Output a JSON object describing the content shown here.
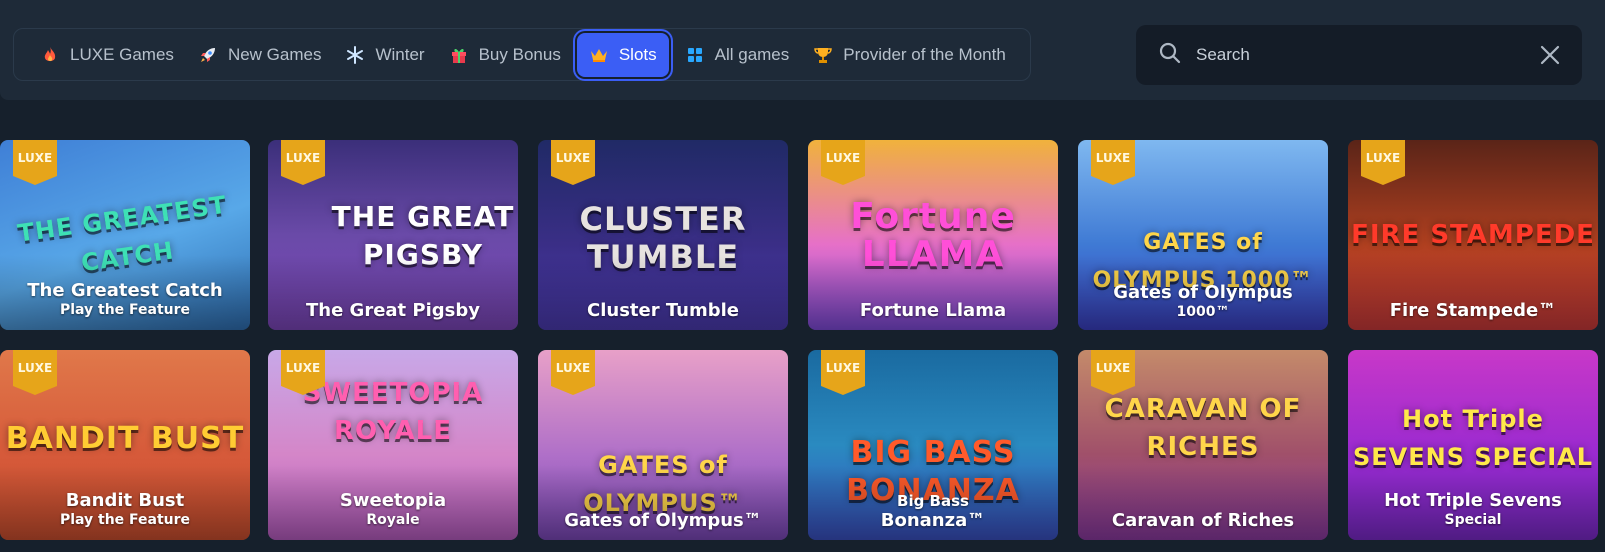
{
  "categories": [
    {
      "label": "LUXE Games",
      "icon": "flame-icon",
      "active": false
    },
    {
      "label": "New Games",
      "icon": "rocket-icon",
      "active": false
    },
    {
      "label": "Winter",
      "icon": "snowflake-icon",
      "active": false
    },
    {
      "label": "Buy Bonus",
      "icon": "gift-icon",
      "active": false
    },
    {
      "label": "Slots",
      "icon": "crown-icon",
      "active": true
    },
    {
      "label": "All games",
      "icon": "grid-icon",
      "active": false
    },
    {
      "label": "Provider of the Month",
      "icon": "trophy-icon",
      "active": false
    }
  ],
  "search": {
    "placeholder": "Search"
  },
  "badge_label": "LUXE",
  "games": [
    {
      "title": "The Greatest Catch",
      "subtitle": "Play the Feature",
      "logo": "THE GREATEST CATCH",
      "luxe": true
    },
    {
      "title": "The Great Pigsby",
      "subtitle": "",
      "logo": "THE GREAT PIGSBY",
      "luxe": true
    },
    {
      "title": "Cluster Tumble",
      "subtitle": "",
      "logo": "CLUSTER TUMBLE",
      "luxe": true
    },
    {
      "title": "Fortune Llama",
      "subtitle": "",
      "logo": "Fortune LLAMA",
      "luxe": true
    },
    {
      "title": "Gates of Olympus",
      "subtitle": "1000™",
      "logo": "GATES of OLYMPUS 1000™",
      "luxe": true
    },
    {
      "title": "Fire Stampede™",
      "subtitle": "",
      "logo": "FIRE STAMPEDE",
      "luxe": true
    },
    {
      "title": "Bandit Bust",
      "subtitle": "Play the Feature",
      "logo": "BANDIT BUST",
      "luxe": true
    },
    {
      "title": "Sweetopia",
      "subtitle": "Royale",
      "logo": "SWEETOPIA ROYALE",
      "luxe": true
    },
    {
      "title": "Gates of Olympus™",
      "subtitle": "",
      "logo": "GATES of OLYMPUS™",
      "luxe": true
    },
    {
      "title": "Big Bass",
      "subtitle": "Bonanza™",
      "logo": "BIG BASS BONANZA",
      "luxe": true
    },
    {
      "title": "Caravan of Riches",
      "subtitle": "",
      "logo": "CARAVAN OF RICHES",
      "luxe": true
    },
    {
      "title": "Hot Triple Sevens",
      "subtitle": "Special",
      "logo": "Hot Triple SEVENS SPECIAL",
      "luxe": false
    }
  ],
  "colors": {
    "accent": "#3b5ef5",
    "badge": "#e6a51a",
    "background": "#16202c",
    "topbar": "#1e2a38"
  }
}
